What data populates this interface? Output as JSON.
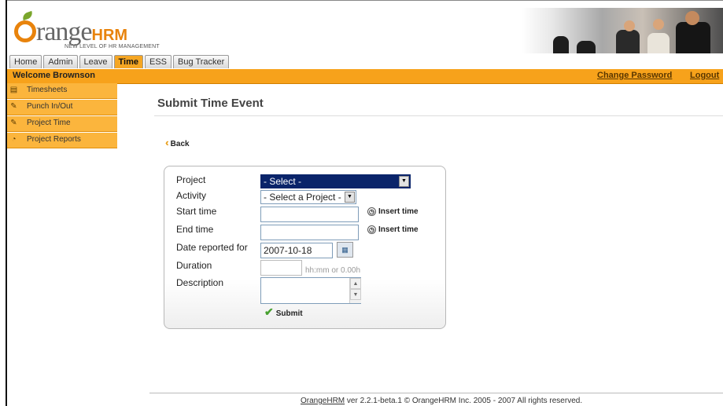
{
  "brand": {
    "logo_word": "range",
    "logo_suffix": "HRM",
    "tagline": "NEW LEVEL OF HR MANAGEMENT"
  },
  "tabs": [
    {
      "label": "Home"
    },
    {
      "label": "Admin"
    },
    {
      "label": "Leave"
    },
    {
      "label": "Time",
      "active": true
    },
    {
      "label": "ESS"
    },
    {
      "label": "Bug Tracker"
    }
  ],
  "menubar": {
    "welcome": "Welcome Brownson",
    "change_password": "Change Password",
    "logout": "Logout"
  },
  "sidebar": {
    "items": [
      {
        "label": "Timesheets",
        "icon": "timesheet-icon"
      },
      {
        "label": "Punch In/Out",
        "icon": "punch-icon"
      },
      {
        "label": "Project Time",
        "icon": "project-time-icon"
      },
      {
        "label": "Project Reports",
        "icon": "reports-icon"
      }
    ]
  },
  "main": {
    "title": "Submit Time Event",
    "back_label": "Back",
    "form": {
      "project_label": "Project",
      "project_value": "- Select -",
      "activity_label": "Activity",
      "activity_value": "- Select a Project -",
      "start_label": "Start time",
      "end_label": "End time",
      "insert_time": "Insert time",
      "date_label": "Date reported for",
      "date_value": "2007-10-18",
      "duration_label": "Duration",
      "duration_hint": "hh:mm or 0.00h",
      "description_label": "Description",
      "submit_label": "Submit"
    }
  },
  "footer": {
    "link": "OrangeHRM",
    "text": " ver 2.2.1-beta.1 © OrangeHRM Inc. 2005 - 2007 All rights reserved."
  },
  "colors": {
    "accent": "#f7a21b",
    "sidebar": "#fbb53d",
    "selected": "#0a246a",
    "logo_orange": "#e8830c"
  }
}
